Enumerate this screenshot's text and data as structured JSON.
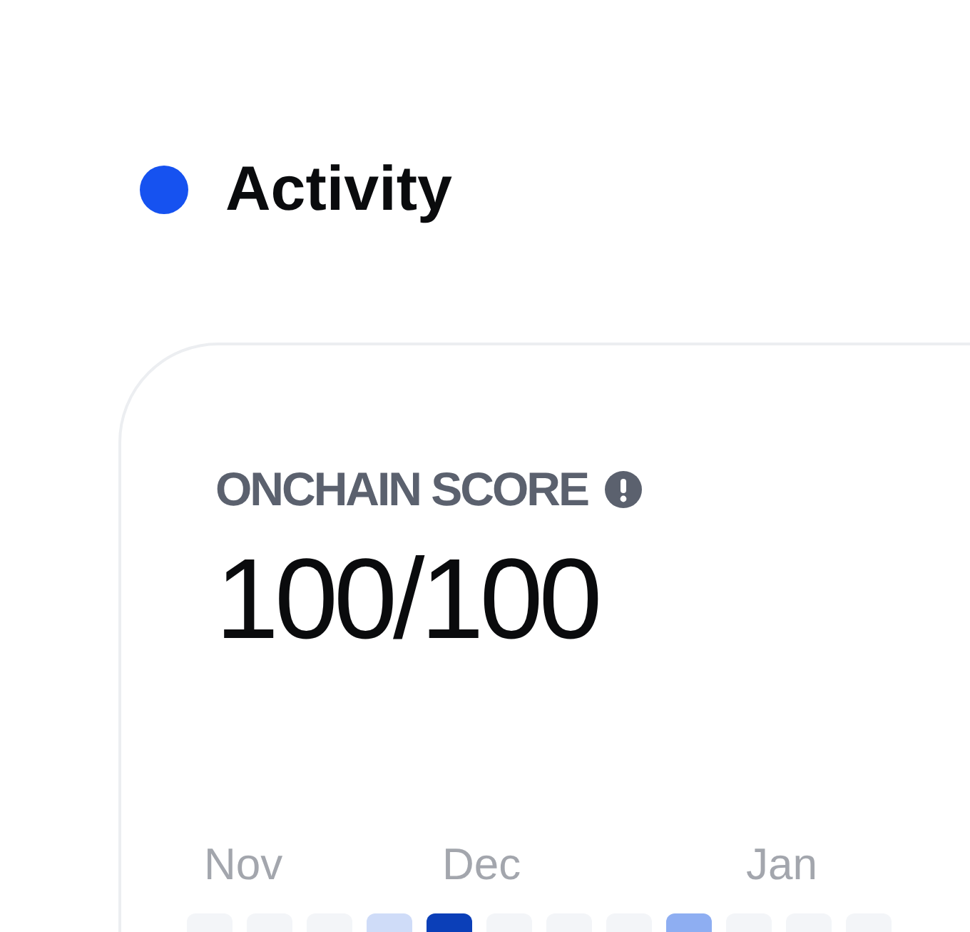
{
  "section": {
    "title": "Activity"
  },
  "score": {
    "label": "ONCHAIN SCORE",
    "value": "100/100"
  },
  "heatmap": {
    "months": [
      "Nov",
      "Dec",
      "Jan"
    ],
    "cells": [
      {
        "color": "#f3f5f8"
      },
      {
        "color": "#f3f5f8"
      },
      {
        "color": "#f3f5f8"
      },
      {
        "color": "#cfdcf8"
      },
      {
        "color": "#0b3fb8"
      },
      {
        "color": "#f3f5f8"
      },
      {
        "color": "#f3f5f8"
      },
      {
        "color": "#f3f5f8"
      },
      {
        "color": "#8eaef2"
      },
      {
        "color": "#f3f5f8"
      },
      {
        "color": "#f3f5f8"
      },
      {
        "color": "#f3f5f8"
      }
    ]
  }
}
